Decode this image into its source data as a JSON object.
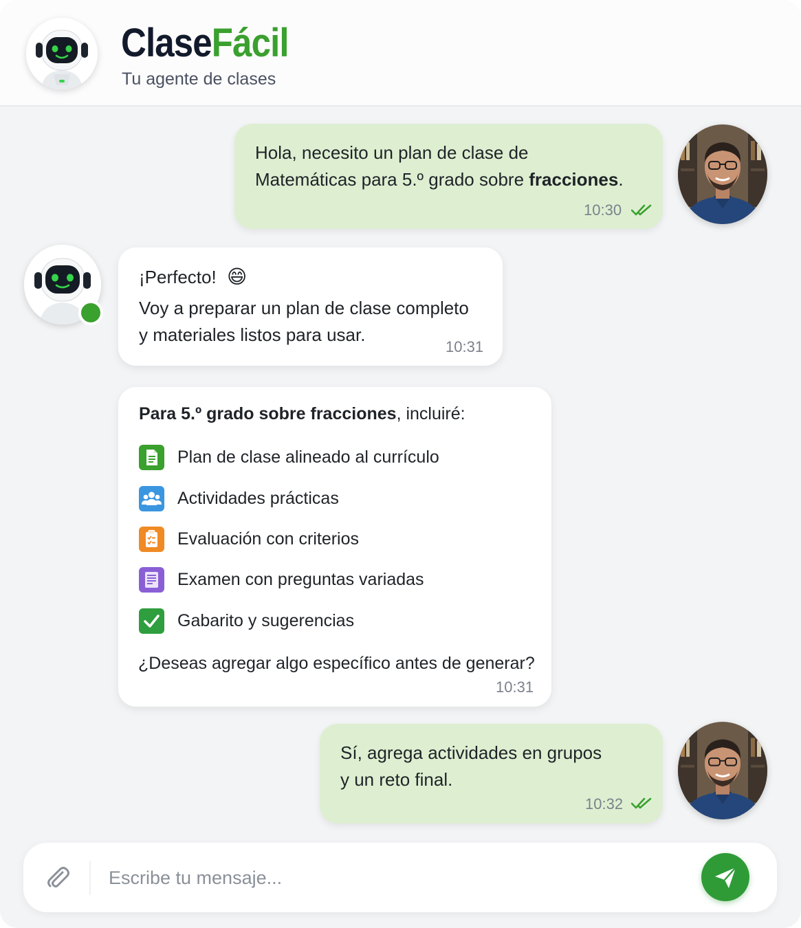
{
  "header": {
    "brand_part1": "Clase",
    "brand_part2": "Fácil",
    "tagline": "Tu agente de clases",
    "brand_color": "#3aa02e"
  },
  "messages": [
    {
      "sender": "user",
      "text_plain": "Hola, necesito un plan de clase de Matemáticas para 5.º grado sobre ",
      "line1": "Hola, necesito un plan de clase de",
      "line2_pre": "Matemáticas para 5.º grado sobre ",
      "line2_bold": "fracciones",
      "line2_post": ".",
      "time": "10:30",
      "status": "read-double-check"
    },
    {
      "sender": "bot",
      "line1": "¡Perfecto!",
      "emoji": "😄",
      "line2": "Voy a preparar un plan de clase completo",
      "line3": "y materiales listos para usar.",
      "time": "10:31"
    },
    {
      "sender": "bot",
      "intro_bold": "Para 5.º grado sobre fracciones",
      "intro_rest": ", incluiré:",
      "items": [
        {
          "label": "Plan de clase alineado al currículo",
          "icon": "document-icon",
          "color": "#3aa02e"
        },
        {
          "label": "Actividades prácticas",
          "icon": "group-icon",
          "color": "#3b96e0"
        },
        {
          "label": "Evaluación con criterios",
          "icon": "clipboard-icon",
          "color": "#f08a24"
        },
        {
          "label": "Examen con preguntas variadas",
          "icon": "exam-icon",
          "color": "#8a5fd6"
        },
        {
          "label": "Gabarito y sugerencias",
          "icon": "checkmark-icon",
          "color": "#2e9e3e"
        }
      ],
      "question": "¿Deseas agregar algo específico antes de generar?",
      "time": "10:31"
    },
    {
      "sender": "user",
      "line1": "Sí, agrega actividades en grupos",
      "line2": "y un reto final.",
      "time": "10:32",
      "status": "read-double-check"
    }
  ],
  "composer": {
    "placeholder": "Escribe tu mensaje...",
    "attach_icon": "paperclip-icon",
    "send_icon": "paper-plane-icon",
    "send_color": "#2f9b37"
  },
  "colors": {
    "outgoing_bubble": "#deefd1",
    "incoming_bubble": "#ffffff",
    "background": "#f3f4f6",
    "read_ticks": "#3aa02e"
  }
}
